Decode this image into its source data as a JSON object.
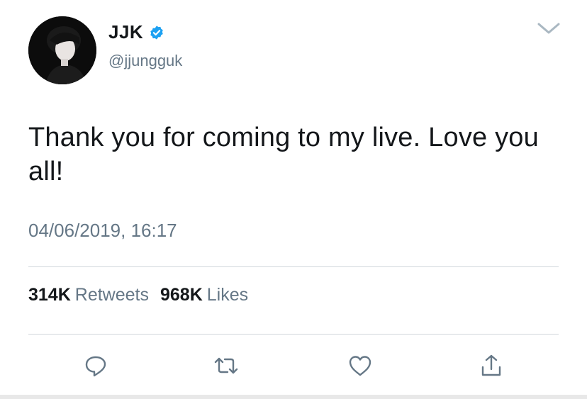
{
  "author": {
    "display_name": "JJK",
    "handle": "@jjungguk",
    "verified": true
  },
  "tweet": {
    "text": "Thank you for coming to my live. Love you all!",
    "timestamp": "04/06/2019, 16:17"
  },
  "stats": {
    "retweets_count": "314K",
    "retweets_label": "Retweets",
    "likes_count": "968K",
    "likes_label": "Likes"
  },
  "actions": [
    "reply-icon",
    "retweet-icon",
    "like-icon",
    "share-icon"
  ],
  "colors": {
    "text": "#14171a",
    "secondary": "#657786",
    "verified": "#1da1f2",
    "icon": "#657786",
    "divider": "#d0d6db"
  }
}
